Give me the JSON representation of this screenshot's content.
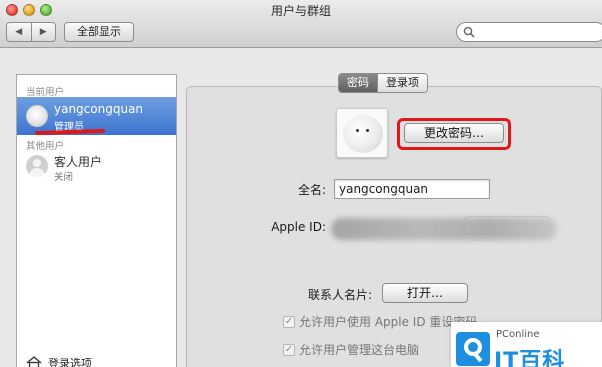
{
  "window": {
    "title": "用户与群组"
  },
  "toolbar": {
    "back_glyph": "◀",
    "forward_glyph": "▶",
    "show_all_label": "全部显示",
    "search_placeholder": ""
  },
  "sidebar": {
    "current_users_heading": "当前用户",
    "other_users_heading": "其他用户",
    "selected_user": {
      "name": "yangcongquan",
      "role": "管理员"
    },
    "guest_user": {
      "name": "客人用户",
      "status": "关闭"
    },
    "login_options_label": "登录选项"
  },
  "tabs": [
    {
      "label": "密码",
      "active": true
    },
    {
      "label": "登录项",
      "active": false
    }
  ],
  "account": {
    "change_password_label": "更改密码…",
    "full_name_label": "全名:",
    "full_name_value": "yangcongquan",
    "apple_id_label": "Apple ID:",
    "contact_card_label": "联系人名片:",
    "open_label": "打开…",
    "allow_reset_label": "允许用户使用 Apple ID 重设密码",
    "allow_admin_label": "允许用户管理这台电脑",
    "check_glyph": "✓"
  },
  "watermark": {
    "small_text": "PConline",
    "big_text": "IT百科"
  },
  "colors": {
    "selection_blue": "#3e74cf",
    "highlight_red": "#e01818",
    "watermark_blue": "#1e8fe0"
  }
}
